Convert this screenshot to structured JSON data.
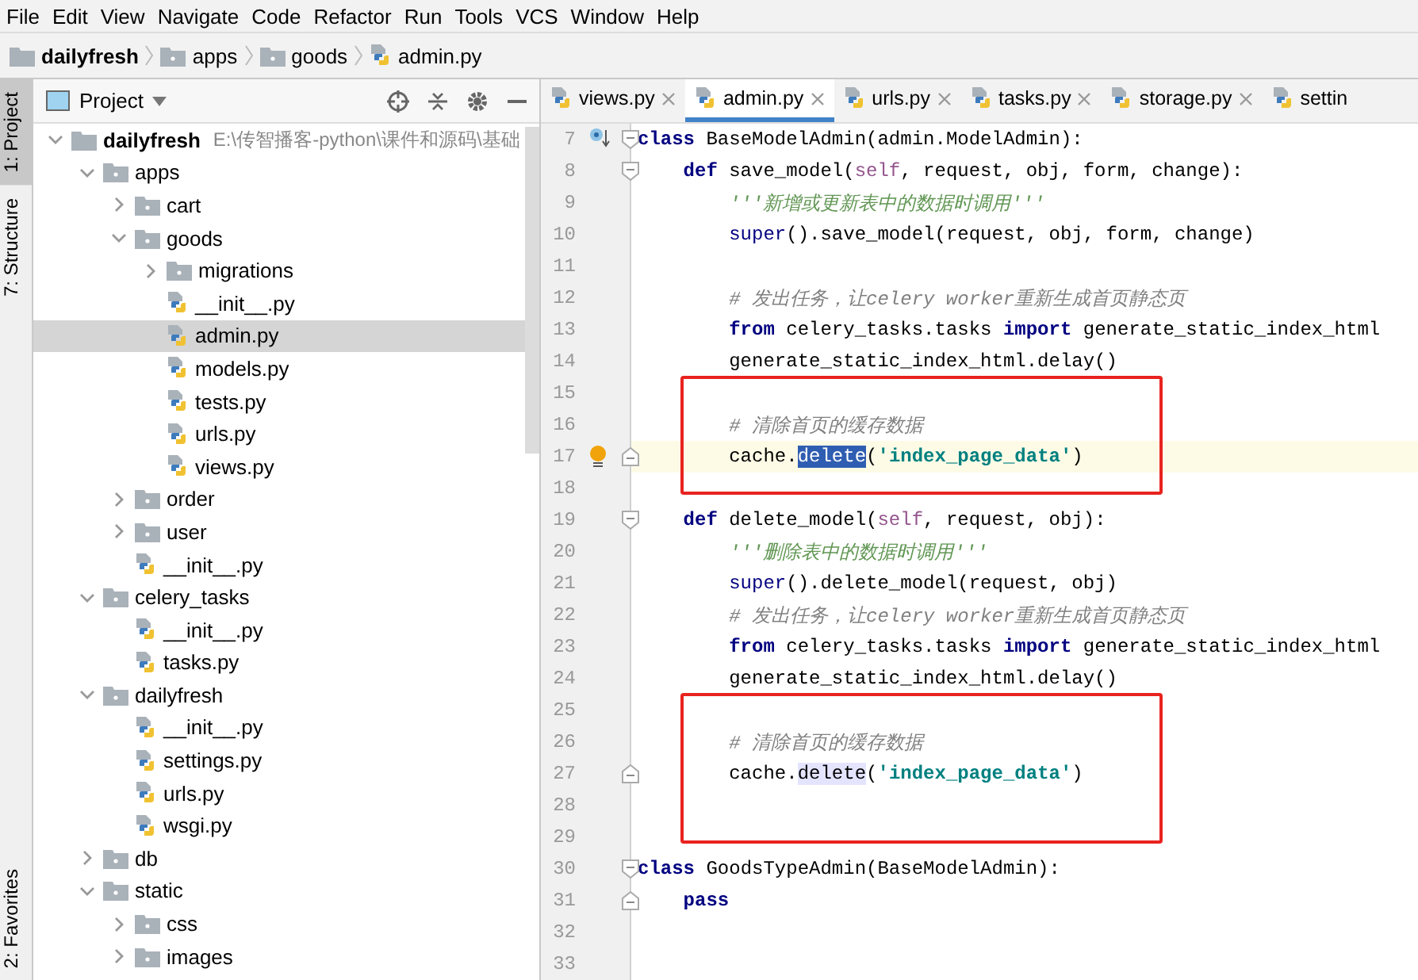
{
  "menu": [
    "File",
    "Edit",
    "View",
    "Navigate",
    "Code",
    "Refactor",
    "Run",
    "Tools",
    "VCS",
    "Window",
    "Help"
  ],
  "breadcrumb": [
    {
      "label": "dailyfresh",
      "kind": "project"
    },
    {
      "label": "apps",
      "kind": "folder"
    },
    {
      "label": "goods",
      "kind": "folder"
    },
    {
      "label": "admin.py",
      "kind": "python"
    }
  ],
  "tool_strip": {
    "top": [
      {
        "label": "1: Project",
        "selected": true
      },
      {
        "label": "7: Structure",
        "selected": false
      }
    ],
    "bottom": [
      {
        "label": "2: Favorites",
        "selected": false
      }
    ]
  },
  "project_panel": {
    "title": "Project",
    "tree": [
      {
        "label": "dailyfresh",
        "path": "E:\\传智播客-python\\课件和源码\\基础",
        "kind": "project",
        "expanded": true,
        "selected": false,
        "children": [
          {
            "label": "apps",
            "kind": "folder",
            "expanded": true,
            "selected": false,
            "children": [
              {
                "label": "cart",
                "kind": "folder",
                "expanded": false,
                "selected": false
              },
              {
                "label": "goods",
                "kind": "folder",
                "expanded": true,
                "selected": false,
                "children": [
                  {
                    "label": "migrations",
                    "kind": "folder",
                    "expanded": false,
                    "selected": false
                  },
                  {
                    "label": "__init__.py",
                    "kind": "python",
                    "selected": false
                  },
                  {
                    "label": "admin.py",
                    "kind": "python",
                    "selected": true
                  },
                  {
                    "label": "models.py",
                    "kind": "python",
                    "selected": false
                  },
                  {
                    "label": "tests.py",
                    "kind": "python",
                    "selected": false
                  },
                  {
                    "label": "urls.py",
                    "kind": "python",
                    "selected": false
                  },
                  {
                    "label": "views.py",
                    "kind": "python",
                    "selected": false
                  }
                ]
              },
              {
                "label": "order",
                "kind": "folder",
                "expanded": false,
                "selected": false
              },
              {
                "label": "user",
                "kind": "folder",
                "expanded": false,
                "selected": false
              },
              {
                "label": "__init__.py",
                "kind": "python",
                "selected": false
              }
            ]
          },
          {
            "label": "celery_tasks",
            "kind": "folder",
            "expanded": true,
            "selected": false,
            "children": [
              {
                "label": "__init__.py",
                "kind": "python",
                "selected": false
              },
              {
                "label": "tasks.py",
                "kind": "python",
                "selected": false
              }
            ]
          },
          {
            "label": "dailyfresh",
            "kind": "folder",
            "expanded": true,
            "selected": false,
            "children": [
              {
                "label": "__init__.py",
                "kind": "python",
                "selected": false
              },
              {
                "label": "settings.py",
                "kind": "python",
                "selected": false
              },
              {
                "label": "urls.py",
                "kind": "python",
                "selected": false
              },
              {
                "label": "wsgi.py",
                "kind": "python",
                "selected": false
              }
            ]
          },
          {
            "label": "db",
            "kind": "folder",
            "expanded": false,
            "selected": false
          },
          {
            "label": "static",
            "kind": "folder",
            "expanded": true,
            "selected": false,
            "children": [
              {
                "label": "css",
                "kind": "folder",
                "expanded": false,
                "selected": false
              },
              {
                "label": "images",
                "kind": "folder",
                "expanded": false,
                "selected": false
              }
            ]
          }
        ]
      }
    ]
  },
  "editor": {
    "tabs": [
      {
        "label": "views.py",
        "selected": false,
        "closable": true
      },
      {
        "label": "admin.py",
        "selected": true,
        "closable": true
      },
      {
        "label": "urls.py",
        "selected": false,
        "closable": true
      },
      {
        "label": "tasks.py",
        "selected": false,
        "closable": true
      },
      {
        "label": "storage.py",
        "selected": false,
        "closable": true
      },
      {
        "label": "settin",
        "selected": false,
        "closable": false
      }
    ],
    "lines": [
      {
        "number": "7",
        "override_marker": true,
        "fold_start": true,
        "current": false,
        "boxed": false,
        "tokens": [
          {
            "kind": "kw",
            "text": "class"
          },
          {
            "kind": "text",
            "text": " BaseModelAdmin(admin.ModelAdmin):"
          }
        ],
        "children": [
          {
            "number": "8",
            "fold_start": true,
            "current": false,
            "boxed": false,
            "tokens": [
              {
                "kind": "kw",
                "text": "def"
              },
              {
                "kind": "text",
                "text": " save_model("
              },
              {
                "kind": "self",
                "text": "self"
              },
              {
                "kind": "text",
                "text": ", request, obj, form, change):"
              }
            ],
            "children": [
              {
                "number": "9",
                "current": false,
                "boxed": false,
                "tokens": [
                  {
                    "kind": "doc",
                    "text": "'''新增或更新表中的数据时调用'''"
                  }
                ]
              },
              {
                "number": "10",
                "current": false,
                "boxed": false,
                "tokens": [
                  {
                    "kind": "builtin",
                    "text": "super"
                  },
                  {
                    "kind": "text",
                    "text": "().save_model(request, obj, form, change)"
                  }
                ]
              },
              {
                "number": "11",
                "current": false,
                "boxed": false
              },
              {
                "number": "12",
                "current": false,
                "boxed": false,
                "tokens": [
                  {
                    "kind": "comment",
                    "text": "# 发出任务，让celery worker重新生成首页静态页"
                  }
                ]
              },
              {
                "number": "13",
                "current": false,
                "boxed": false,
                "tokens": [
                  {
                    "kind": "kw",
                    "text": "from"
                  },
                  {
                    "kind": "text",
                    "text": " celery_tasks.tasks "
                  },
                  {
                    "kind": "kw",
                    "text": "import"
                  },
                  {
                    "kind": "text",
                    "text": " generate_static_index_html"
                  }
                ]
              },
              {
                "number": "14",
                "current": false,
                "boxed": false,
                "tokens": [
                  {
                    "kind": "text",
                    "text": "generate_static_index_html.delay()"
                  }
                ]
              },
              {
                "number": "15",
                "current": false,
                "boxed": true
              },
              {
                "number": "16",
                "current": false,
                "boxed": true,
                "tokens": [
                  {
                    "kind": "comment",
                    "text": "# 清除首页的缓存数据"
                  }
                ]
              },
              {
                "number": "17",
                "bulb": true,
                "fold_end": true,
                "current": true,
                "boxed": true,
                "tokens": [
                  {
                    "kind": "text",
                    "text": "cache."
                  },
                  {
                    "kind": "selected",
                    "text": "delete"
                  },
                  {
                    "kind": "text",
                    "text": "("
                  },
                  {
                    "kind": "str",
                    "text": "'index_page_data'"
                  },
                  {
                    "kind": "text",
                    "text": ")"
                  }
                ]
              }
            ]
          },
          {
            "number": "18",
            "current": false,
            "boxed": false
          },
          {
            "number": "19",
            "fold_start": true,
            "current": false,
            "boxed": false,
            "tokens": [
              {
                "kind": "kw",
                "text": "def"
              },
              {
                "kind": "text",
                "text": " delete_model("
              },
              {
                "kind": "self",
                "text": "self"
              },
              {
                "kind": "text",
                "text": ", request, obj):"
              }
            ],
            "children": [
              {
                "number": "20",
                "current": false,
                "boxed": false,
                "tokens": [
                  {
                    "kind": "doc",
                    "text": "'''删除表中的数据时调用'''"
                  }
                ]
              },
              {
                "number": "21",
                "current": false,
                "boxed": false,
                "tokens": [
                  {
                    "kind": "builtin",
                    "text": "super"
                  },
                  {
                    "kind": "text",
                    "text": "().delete_model(request, obj)"
                  }
                ]
              },
              {
                "number": "22",
                "current": false,
                "boxed": false,
                "tokens": [
                  {
                    "kind": "comment",
                    "text": "# 发出任务，让celery worker重新生成首页静态页"
                  }
                ]
              },
              {
                "number": "23",
                "current": false,
                "boxed": false,
                "tokens": [
                  {
                    "kind": "kw",
                    "text": "from"
                  },
                  {
                    "kind": "text",
                    "text": " celery_tasks.tasks "
                  },
                  {
                    "kind": "kw",
                    "text": "import"
                  },
                  {
                    "kind": "text",
                    "text": " generate_static_index_html"
                  }
                ]
              },
              {
                "number": "24",
                "current": false,
                "boxed": false,
                "tokens": [
                  {
                    "kind": "text",
                    "text": "generate_static_index_html.delay()"
                  }
                ]
              },
              {
                "number": "25",
                "current": false,
                "boxed": true
              },
              {
                "number": "26",
                "current": false,
                "boxed": true,
                "tokens": [
                  {
                    "kind": "comment",
                    "text": "# 清除首页的缓存数据"
                  }
                ]
              },
              {
                "number": "27",
                "fold_end": true,
                "current": false,
                "boxed": true,
                "tokens": [
                  {
                    "kind": "text",
                    "text": "cache."
                  },
                  {
                    "kind": "usage",
                    "text": "delete"
                  },
                  {
                    "kind": "text",
                    "text": "("
                  },
                  {
                    "kind": "str",
                    "text": "'index_page_data'"
                  },
                  {
                    "kind": "text",
                    "text": ")"
                  }
                ]
              },
              {
                "number": "28",
                "current": false,
                "boxed": true
              }
            ]
          }
        ]
      },
      {
        "number": "29",
        "current": false,
        "boxed": false
      },
      {
        "number": "30",
        "fold_start": true,
        "current": false,
        "boxed": false,
        "tokens": [
          {
            "kind": "kw",
            "text": "class"
          },
          {
            "kind": "text",
            "text": " GoodsTypeAdmin(BaseModelAdmin):"
          }
        ],
        "children": [
          {
            "number": "31",
            "fold_end": true,
            "current": false,
            "boxed": false,
            "tokens": [
              {
                "kind": "kw",
                "text": "pass"
              }
            ]
          }
        ]
      },
      {
        "number": "32",
        "current": false,
        "boxed": false
      },
      {
        "number": "33",
        "current": false,
        "boxed": false
      }
    ]
  }
}
